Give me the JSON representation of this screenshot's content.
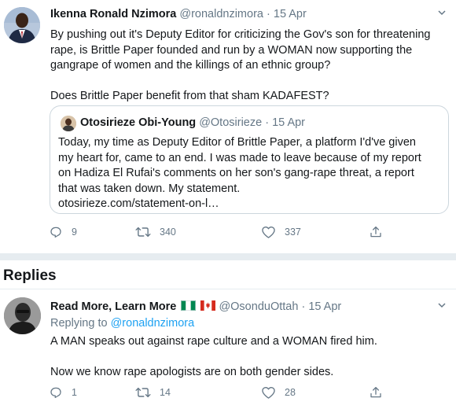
{
  "main_tweet": {
    "name": "Ikenna Ronald Nzimora",
    "handle": "@ronaldnzimora",
    "separator": "·",
    "date": "15 Apr",
    "paragraphs": [
      "By pushing out it's Deputy Editor for criticizing the Gov's son for threatening rape, is Brittle Paper founded and run by a WOMAN now supporting the gangrape of women and the killings of an ethnic group?",
      "Does Brittle Paper benefit from that sham KADAFEST?"
    ],
    "quoted": {
      "name": "Otosirieze Obi-Young",
      "handle": "@Otosirieze",
      "separator": "·",
      "date": "15 Apr",
      "text_lines": [
        "Today, my time as Deputy Editor of Brittle Paper, a platform I'd've given",
        "my heart for, came to an end. I was made to leave because of my report",
        "on Hadiza El Rufai's comments on her son's gang-rape threat, a report",
        "that was taken down. My statement."
      ],
      "link": "otosirieze.com/statement-on-l…"
    },
    "actions": {
      "replies": "9",
      "retweets": "340",
      "likes": "337"
    }
  },
  "replies_section": {
    "heading": "Replies"
  },
  "reply": {
    "name": "Read More, Learn More",
    "handle": "@OsonduOttah",
    "separator": "·",
    "date": "15 Apr",
    "replying_prefix": "Replying to",
    "replying_to": "@ronaldnzimora",
    "paragraphs": [
      "A MAN speaks out against rape culture and a WOMAN fired him.",
      "Now we know rape apologists are on both gender sides."
    ],
    "actions": {
      "replies": "1",
      "retweets": "14",
      "likes": "28"
    }
  },
  "icons": {
    "reply": "reply-icon",
    "retweet": "retweet-icon",
    "like": "heart-icon",
    "share": "share-icon",
    "more": "chevron-down-icon",
    "flags": [
      "nigeria-flag-icon",
      "canada-flag-icon"
    ]
  },
  "colors": {
    "text": "#14171a",
    "secondary": "#657786",
    "link": "#1da1f2",
    "border": "#ccd6dd",
    "divider": "#e6ecf0"
  }
}
